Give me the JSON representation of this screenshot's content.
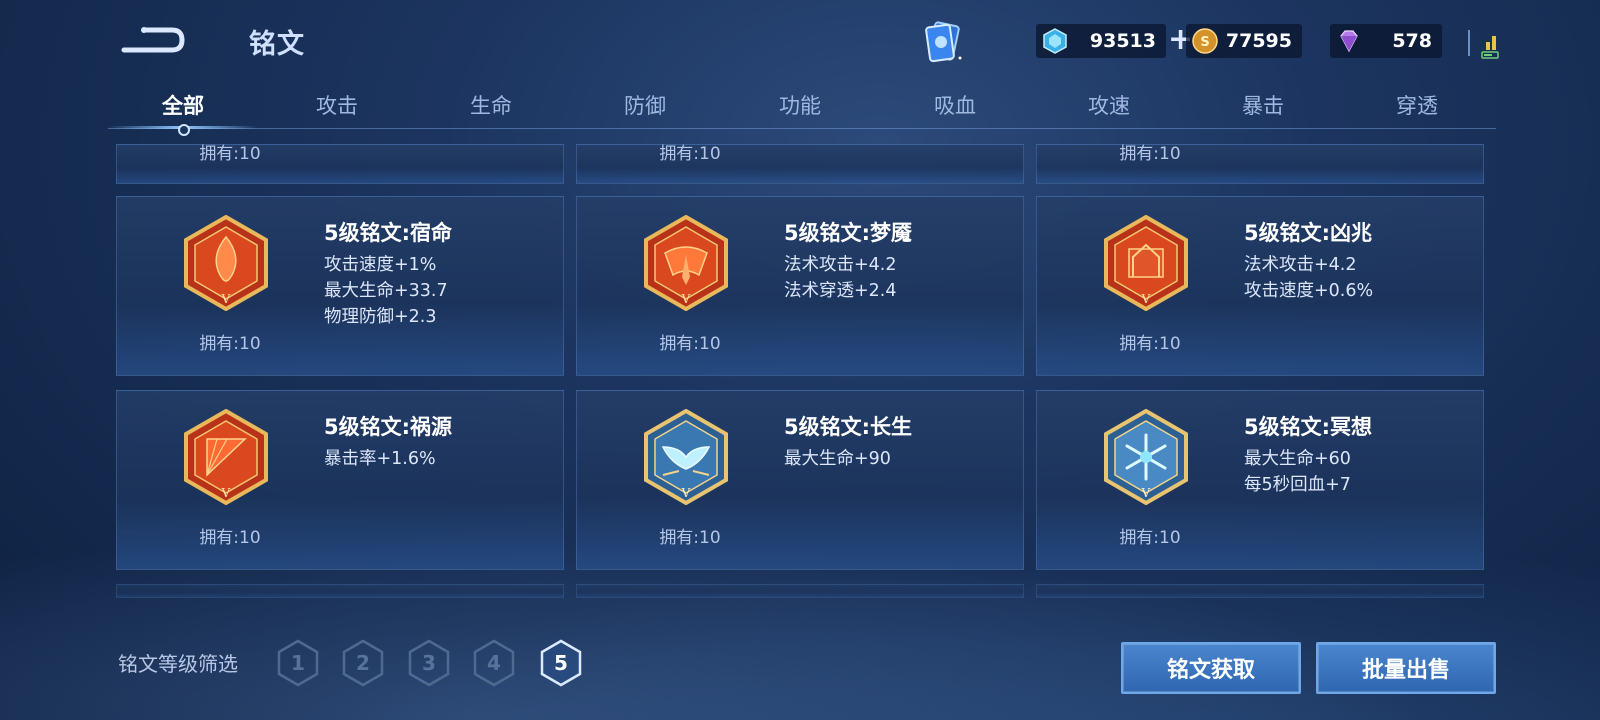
{
  "header": {
    "title": "铭文",
    "currencies": [
      {
        "icon": "blue-crystal-icon",
        "value": "93513"
      },
      {
        "icon": "gold-coin-icon",
        "value": "77595"
      },
      {
        "icon": "purple-diamond-icon",
        "value": "578"
      }
    ],
    "plus_label": "+"
  },
  "tabs": [
    "全部",
    "攻击",
    "生命",
    "防御",
    "功能",
    "吸血",
    "攻速",
    "暴击",
    "穿透"
  ],
  "active_tab": "全部",
  "partial_row": {
    "owned": "拥有:10"
  },
  "cards": [
    {
      "name": "5级铭文:宿命",
      "stats": [
        "攻击速度+1%",
        "最大生命+33.7",
        "物理防御+2.3"
      ],
      "owned": "拥有:10",
      "color": "red",
      "icon": "flame-emblem-icon"
    },
    {
      "name": "5级铭文:梦魇",
      "stats": [
        "法术攻击+4.2",
        "法术穿透+2.4"
      ],
      "owned": "拥有:10",
      "color": "red",
      "icon": "demon-emblem-icon"
    },
    {
      "name": "5级铭文:凶兆",
      "stats": [
        "法术攻击+4.2",
        "攻击速度+0.6%"
      ],
      "owned": "拥有:10",
      "color": "red",
      "icon": "omen-emblem-icon"
    },
    {
      "name": "5级铭文:祸源",
      "stats": [
        "暴击率+1.6%"
      ],
      "owned": "拥有:10",
      "color": "red",
      "icon": "fan-emblem-icon"
    },
    {
      "name": "5级铭文:长生",
      "stats": [
        "最大生命+90"
      ],
      "owned": "拥有:10",
      "color": "blue",
      "icon": "wing-emblem-icon"
    },
    {
      "name": "5级铭文:冥想",
      "stats": [
        "最大生命+60",
        "每5秒回血+7"
      ],
      "owned": "拥有:10",
      "color": "blue",
      "icon": "snowflake-emblem-icon"
    }
  ],
  "emblem_level_mark": "V",
  "filter": {
    "label": "铭文等级筛选",
    "levels": [
      "1",
      "2",
      "3",
      "4",
      "5"
    ],
    "selected": "5"
  },
  "actions": {
    "acquire": "铭文获取",
    "bulk_sell": "批量出售"
  }
}
